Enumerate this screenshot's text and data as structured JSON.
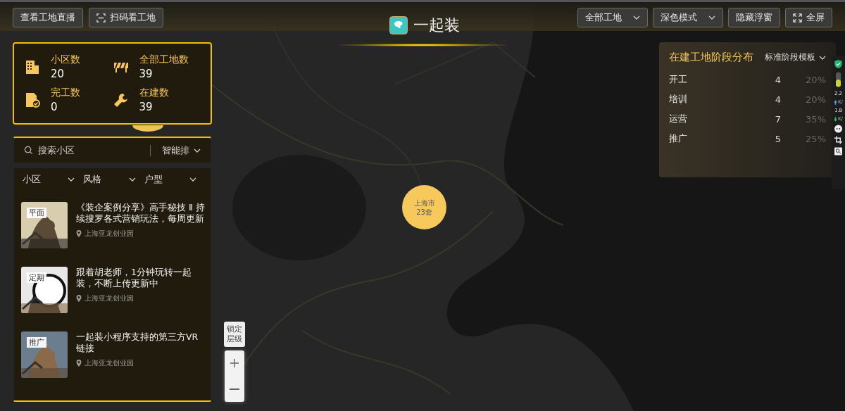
{
  "header": {
    "title": "一起装",
    "left_buttons": [
      {
        "label": "查看工地直播",
        "kind": "plain"
      },
      {
        "label": "扫码看工地",
        "kind": "scan"
      }
    ],
    "dropdowns": [
      {
        "label": "全部工地"
      },
      {
        "label": "深色模式"
      }
    ],
    "right_buttons": [
      {
        "label": "隐藏浮窗",
        "kind": "plain"
      },
      {
        "label": "全屏",
        "kind": "fullscreen"
      }
    ]
  },
  "stats": [
    {
      "label": "小区数",
      "value": "20",
      "kind": "building"
    },
    {
      "label": "全部工地数",
      "value": "39",
      "kind": "barrier"
    },
    {
      "label": "完工数",
      "value": "0",
      "kind": "done"
    },
    {
      "label": "在建数",
      "value": "39",
      "kind": "wrench"
    }
  ],
  "search": {
    "placeholder": "搜索小区",
    "sort": "智能排"
  },
  "filters": [
    "小区",
    "风格",
    "户型"
  ],
  "cases": [
    {
      "tag": "平面",
      "title": "《装企案例分享》高手秘技 Ⅱ 持续搜罗各式营销玩法，每周更新",
      "location": "上海亚龙创业园",
      "kind": "picture"
    },
    {
      "tag": "定期",
      "title": "跟着胡老师，1分钟玩转一起装，不断上传更新中",
      "location": "上海亚龙创业园",
      "kind": "picture"
    },
    {
      "tag": "推广",
      "title": "一起装小程序支持的第三方VR链接",
      "location": "上海亚龙创业园",
      "kind": "picture"
    }
  ],
  "map": {
    "kind": "picture",
    "cluster": {
      "name": "上海市",
      "count": "23套"
    },
    "lock_label": "锁定层级"
  },
  "stage_panel": {
    "title": "在建工地阶段分布",
    "template": "标准阶段模板",
    "rows": [
      {
        "stage": "开工",
        "count": "4",
        "percent": "20%"
      },
      {
        "stage": "培训",
        "count": "4",
        "percent": "20%"
      },
      {
        "stage": "运营",
        "count": "7",
        "percent": "35%"
      },
      {
        "stage": "推广",
        "count": "5",
        "percent": "25%"
      }
    ]
  },
  "side_widget": {
    "readings": [
      {
        "value": "2.2",
        "unit": "K/",
        "kind": "upload"
      },
      {
        "value": "1.8",
        "unit": "K/",
        "kind": "download"
      }
    ]
  }
}
